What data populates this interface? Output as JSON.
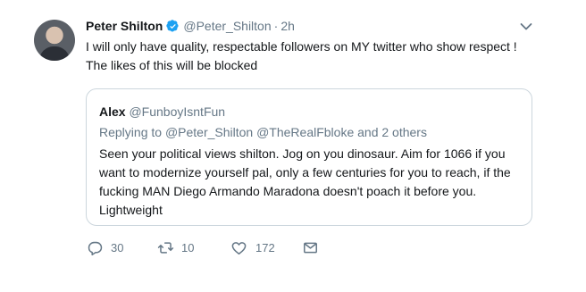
{
  "author": {
    "name": "Peter Shilton",
    "handle": "@Peter_Shilton",
    "separator": "·",
    "time": "2h"
  },
  "tweet": {
    "line1": "I will only have quality, respectable followers on MY twitter who show respect !",
    "line2": "The likes of this will be blocked"
  },
  "quote": {
    "name": "Alex",
    "handle": "@FunboyIsntFun",
    "replying_prefix": "Replying to ",
    "replying_to": "@Peter_Shilton @TheRealFbloke and 2 others",
    "text": "Seen your political views shilton. Jog on you dinosaur. Aim for 1066 if you want to modernize yourself pal, only a few centuries for you to reach, if the fucking MAN Diego Armando Maradona doesn't poach it before you. Lightweight"
  },
  "actions": {
    "replies": "30",
    "retweets": "10",
    "likes": "172"
  },
  "colors": {
    "verified": "#1da1f2",
    "secondary_text": "#657786",
    "border": "#ccd6dd"
  },
  "icons": [
    "verified-badge-icon",
    "chevron-down-icon",
    "reply-icon",
    "retweet-icon",
    "like-icon",
    "direct-message-icon"
  ]
}
